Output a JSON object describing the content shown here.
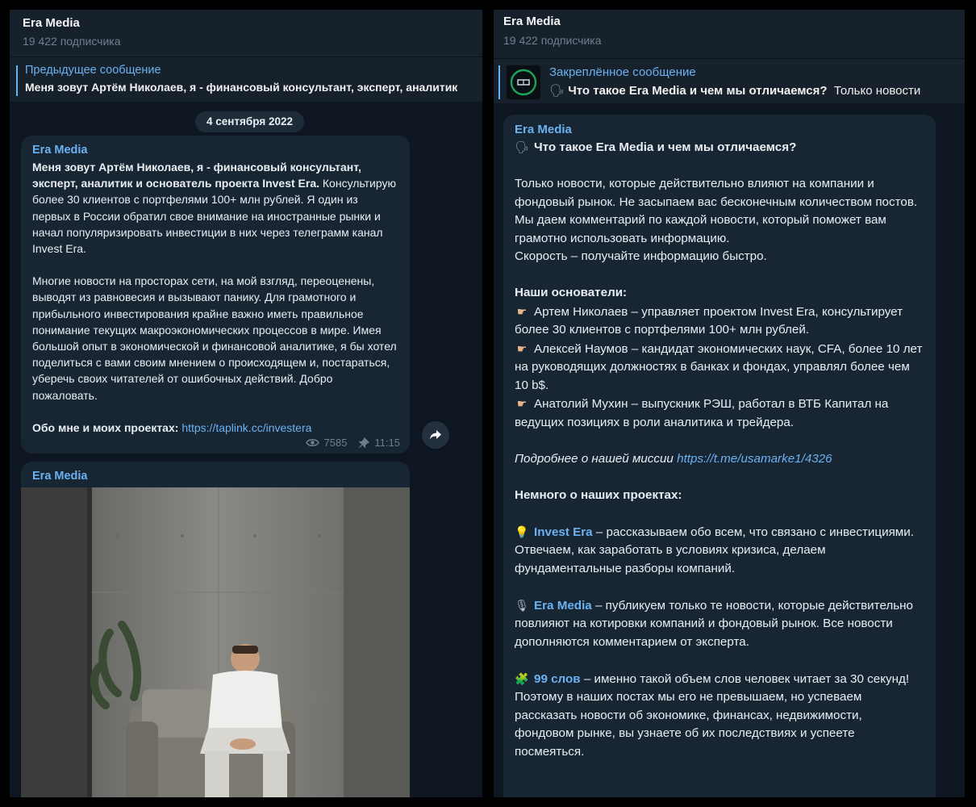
{
  "left": {
    "channel": {
      "title": "Era Media",
      "subscribers": "19 422 подписчика"
    },
    "pinned": {
      "label": "Предыдущее сообщение",
      "text": "Меня зовут Артём Николаев, я - финансовый консультант, эксперт, аналитик"
    },
    "date": "4 сентября 2022",
    "message1": {
      "sender": "Era Media",
      "intro_bold": "Меня зовут Артём Николаев, я - финансовый консультант, эксперт, аналитик и основатель проекта Invest Era.",
      "intro_rest": "Консультирую более 30 клиентов с портфелями 100+ млн рублей. Я один из первых в России обратил свое внимание на иностранные рынки и начал популяризировать инвестиции в них через телеграмм канал Invest Era.",
      "para2": "Многие новости на просторах сети, на мой взгляд, переоценены, выводят из равновесия и вызывают панику. Для грамотного и прибыльного инвестирования крайне важно иметь правильное понимание текущих макроэкономических процессов в мире. Имея большой опыт в экономической и финансовой аналитике, я бы хотел поделиться с вами своим мнением о происходящем и, постараться, уберечь своих читателей от ошибочных действий. Добро пожаловать.",
      "links_label": "Обо мне и моих проектах:",
      "link_url": "https://taplink.cc/investera",
      "views": "7585",
      "time": "11:15"
    },
    "message2": {
      "sender": "Era Media"
    }
  },
  "right": {
    "channel": {
      "title": "Era Media",
      "subscribers": "19 422 подписчика"
    },
    "pinned": {
      "label": "Закреплённое сообщение",
      "title": "Что такое Era Media и чем мы отличаемся?",
      "preview": "Только новости"
    },
    "message": {
      "sender": "Era Media",
      "heading": "Что такое Era Media и чем мы отличаемся?",
      "p1": "Только новости, которые действительно влияют на компании и фондовый рынок. Не засыпаем вас бесконечным количеством постов.",
      "p2": "Мы даем комментарий по каждой новости, который поможет вам грамотно использовать информацию.",
      "p3": "Скорость – получайте информацию быстро.",
      "founders_heading": "Наши основатели:",
      "founder1": "Артем Николаев – управляет проектом Invest Era, консультирует более 30 клиентов с портфелями 100+ млн рублей.",
      "founder2": "Алексей Наумов – кандидат экономических наук, CFA, более 10 лет на руководящих должностях в банках и фондах, управлял более чем 10 b$.",
      "founder3": "Анатолий Мухин – выпускник РЭШ, работал в ВТБ Капитал на ведущих позициях в роли аналитика и трейдера.",
      "mission_label": "Подробнее о нашей миссии",
      "mission_url": "https://t.me/usamarke1/4326",
      "projects_heading": "Немного о наших проектах:",
      "proj1_name": "Invest Era",
      "proj1_text": " – рассказываем обо всем, что связано с инвестициями. Отвечаем, как заработать в условиях кризиса, делаем фундаментальные разборы компаний.",
      "proj2_name": "Era Media",
      "proj2_text": " – публикуем только те новости, которые действительно повлияют на котировки компаний и фондовый рынок. Все новости дополняются комментарием от эксперта.",
      "proj3_name": "99 слов",
      "proj3_text": " – именно такой объем слов человек читает за 30 секунд! Поэтому в наших постах мы его не превышаем, но успеваем рассказать новости об экономике, финансах, недвижимости, фондовом рынке, вы узнаете об их последствиях и успеете посмеяться."
    }
  },
  "colors": {
    "background": "#0e1621",
    "header": "#17212b",
    "bubble": "#182533",
    "accent": "#6ab2f2",
    "muted": "#6d7f8f"
  },
  "icons": [
    "speaking-head-icon",
    "pointing-hand-icon",
    "bulb-icon",
    "microphone-icon",
    "puzzle-icon",
    "eye-icon",
    "pin-icon",
    "share-arrow-icon"
  ]
}
